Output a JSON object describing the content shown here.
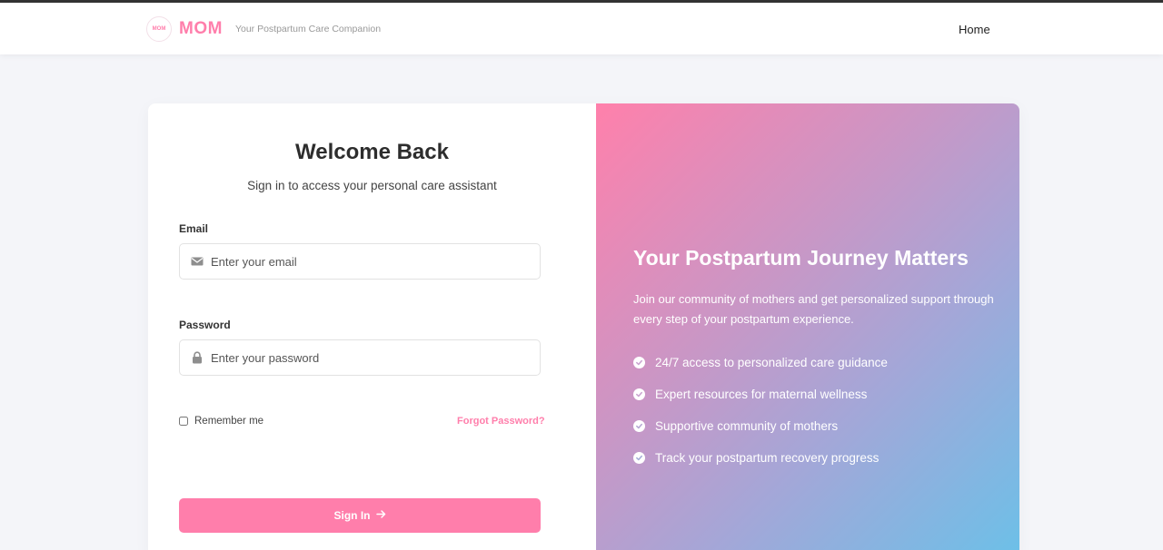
{
  "header": {
    "logo_mark": "MOM",
    "brand": "MOM",
    "tagline": "Your Postpartum Care Companion",
    "nav_home": "Home"
  },
  "login": {
    "title": "Welcome Back",
    "subtitle": "Sign in to access your personal care assistant",
    "email_label": "Email",
    "email_placeholder": "Enter your email",
    "password_label": "Password",
    "password_placeholder": "Enter your password",
    "remember_label": "Remember me",
    "forgot_label": "Forgot Password?",
    "signin_label": "Sign In"
  },
  "promo": {
    "title": "Your Postpartum Journey Matters",
    "description": "Join our community of mothers and get personalized support through every step of your postpartum experience.",
    "features": [
      "24/7 access to personalized care guidance",
      "Expert resources for maternal wellness",
      "Supportive community of mothers",
      "Track your postpartum recovery progress"
    ]
  },
  "colors": {
    "accent": "#ff7eab",
    "gradient_start": "#ff80ab",
    "gradient_end": "#6cc0e8"
  },
  "icons": {
    "email": "envelope-icon",
    "password": "lock-icon",
    "signin": "arrow-right-icon",
    "feature": "check-circle-icon"
  }
}
